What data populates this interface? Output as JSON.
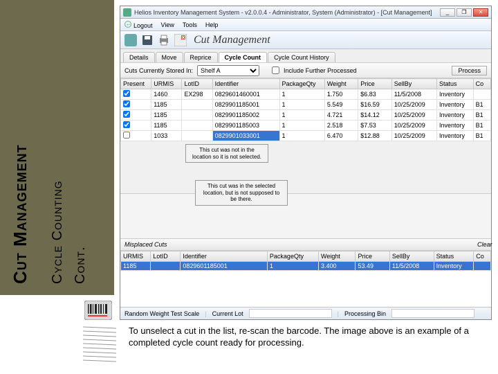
{
  "slide": {
    "title": "Cut Management",
    "subtitle1": "Cycle Counting",
    "subtitle2": "Cont.",
    "footnote": "To unselect a cut in the list, re-scan the barcode. The image above is an example of a completed cycle count ready for processing."
  },
  "window": {
    "title": "Helios Inventory Management System - v2.0.0.4 - Administrator, System (Administrator) - [Cut Management]",
    "menus": {
      "logout": "Logout",
      "view": "View",
      "tools": "Tools",
      "help": "Help"
    },
    "page_title": "Cut Management",
    "tabs": {
      "details": "Details",
      "move": "Move",
      "reprice": "Reprice",
      "cycle_count": "Cycle Count",
      "cycle_count_history": "Cycle Count History"
    },
    "filter": {
      "label": "Cuts Currently Stored In:",
      "value": "Shelf A",
      "include_label": "Include Further Processed",
      "process": "Process"
    },
    "headers": {
      "present": "Present",
      "urmis": "URMIS",
      "lotid": "LotID",
      "identifier": "Identifier",
      "packageqty": "PackageQty",
      "weight": "Weight",
      "price": "Price",
      "sellby": "SellBy",
      "status": "Status",
      "co": "Co"
    },
    "rows": [
      {
        "present": true,
        "urmis": "1460",
        "lotid": "EX298",
        "identifier": "0829601460001",
        "pkg": "1",
        "weight": "1.750",
        "price": "$6.83",
        "sellby": "11/5/2008",
        "status": "Inventory",
        "co": ""
      },
      {
        "present": true,
        "urmis": "1185",
        "lotid": "",
        "identifier": "0829901185001",
        "pkg": "1",
        "weight": "5.549",
        "price": "$16.59",
        "sellby": "10/25/2009",
        "status": "Inventory",
        "co": "B1"
      },
      {
        "present": true,
        "urmis": "1185",
        "lotid": "",
        "identifier": "0829901185002",
        "pkg": "1",
        "weight": "4.721",
        "price": "$14.12",
        "sellby": "10/25/2009",
        "status": "Inventory",
        "co": "B1"
      },
      {
        "present": true,
        "urmis": "1185",
        "lotid": "",
        "identifier": "0829901185003",
        "pkg": "1",
        "weight": "2.518",
        "price": "$7.53",
        "sellby": "10/25/2009",
        "status": "Inventory",
        "co": "B1"
      },
      {
        "present": false,
        "urmis": "1033",
        "lotid": "",
        "identifier": "0829901033001",
        "pkg": "1",
        "weight": "6.470",
        "price": "$12.88",
        "sellby": "10/25/2009",
        "status": "Inventory",
        "co": "B1",
        "selected_identifier": true
      }
    ],
    "notes": {
      "n1": "This cut was not in the location so it is not selected.",
      "n2": "This cut was in the selected location, but is not supposed to be there."
    },
    "misplaced": {
      "title": "Misplaced Cuts",
      "clear": "Clear",
      "row": {
        "urmis": "1185",
        "lotid": "",
        "identifier": "0829601185001",
        "pkg": "1",
        "weight": "3.400",
        "price": "53.49",
        "sellby": "11/5/2008",
        "status": "Inventory",
        "co": ""
      }
    },
    "status": {
      "scale": "Random Weight Test Scale",
      "lot": "Current Lot",
      "bin": "Processing Bin"
    }
  }
}
